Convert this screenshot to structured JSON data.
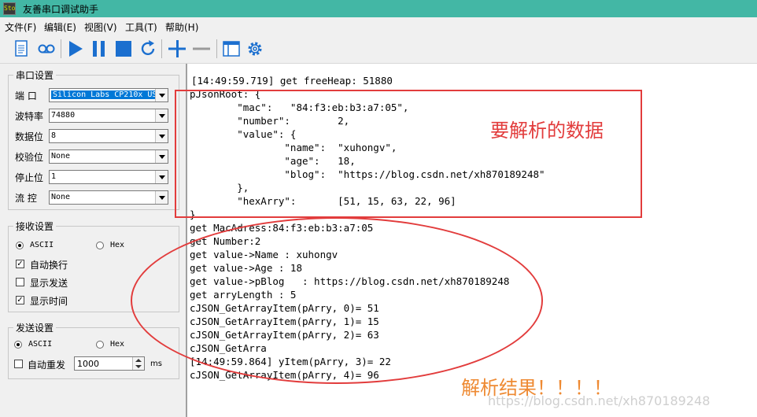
{
  "app": {
    "title": "友善串口调试助手",
    "icon_label": "Sto"
  },
  "menu": [
    "文件(F)",
    "编辑(E)",
    "视图(V)",
    "工具(T)",
    "帮助(H)"
  ],
  "toolbar": {
    "icons": [
      "new-file-icon",
      "record-icon",
      "play-icon",
      "pause-icon",
      "stop-icon",
      "refresh-icon",
      "plus-icon",
      "minus-icon",
      "window-icon",
      "gear-icon"
    ],
    "accent": "#1b6fcf"
  },
  "serial": {
    "title": "串口设置",
    "port_label": "端  口",
    "port_value": "Silicon Labs CP210x US",
    "baud_label": "波特率",
    "baud_value": "74880",
    "databits_label": "数据位",
    "databits_value": "8",
    "parity_label": "校验位",
    "parity_value": "None",
    "stopbits_label": "停止位",
    "stopbits_value": "1",
    "flow_label": "流  控",
    "flow_value": "None"
  },
  "receive": {
    "title": "接收设置",
    "ascii": "ASCII",
    "hex": "Hex",
    "auto_wrap": "自动换行",
    "show_send": "显示发送",
    "show_time": "显示时间"
  },
  "send": {
    "title": "发送设置",
    "ascii": "ASCII",
    "hex": "Hex",
    "auto_resend": "自动重发",
    "interval": "1000",
    "unit": "ms"
  },
  "output_lines": [
    "[14:49:59.719] get freeHeap: 51880",
    "pJsonRoot: {",
    "        \"mac\":   \"84:f3:eb:b3:a7:05\",",
    "        \"number\":        2,",
    "        \"value\": {",
    "                \"name\":  \"xuhongv\",",
    "                \"age\":   18,",
    "                \"blog\":  \"https://blog.csdn.net/xh870189248\"",
    "        },",
    "        \"hexArry\":       [51, 15, 63, 22, 96]",
    "}",
    "get MacAdress:84:f3:eb:b3:a7:05",
    "get Number:2",
    "get value->Name : xuhongv",
    "get value->Age : 18",
    "get value->pBlog   : https://blog.csdn.net/xh870189248",
    "get arryLength : 5",
    "cJSON_GetArrayItem(pArry, 0)= 51",
    "cJSON_GetArrayItem(pArry, 1)= 15",
    "cJSON_GetArrayItem(pArry, 2)= 63",
    "cJSON_GetArra",
    "[14:49:59.864] yItem(pArry, 3)= 22",
    "cJSON_GetArrayItem(pArry, 4)= 96"
  ],
  "annotations": {
    "data_to_parse": "要解析的数据",
    "parse_result": "解析结果！！！！",
    "color_red": "#e23c3c",
    "color_orange": "#ee8a33"
  },
  "watermark": "https://blog.csdn.net/xh870189248"
}
